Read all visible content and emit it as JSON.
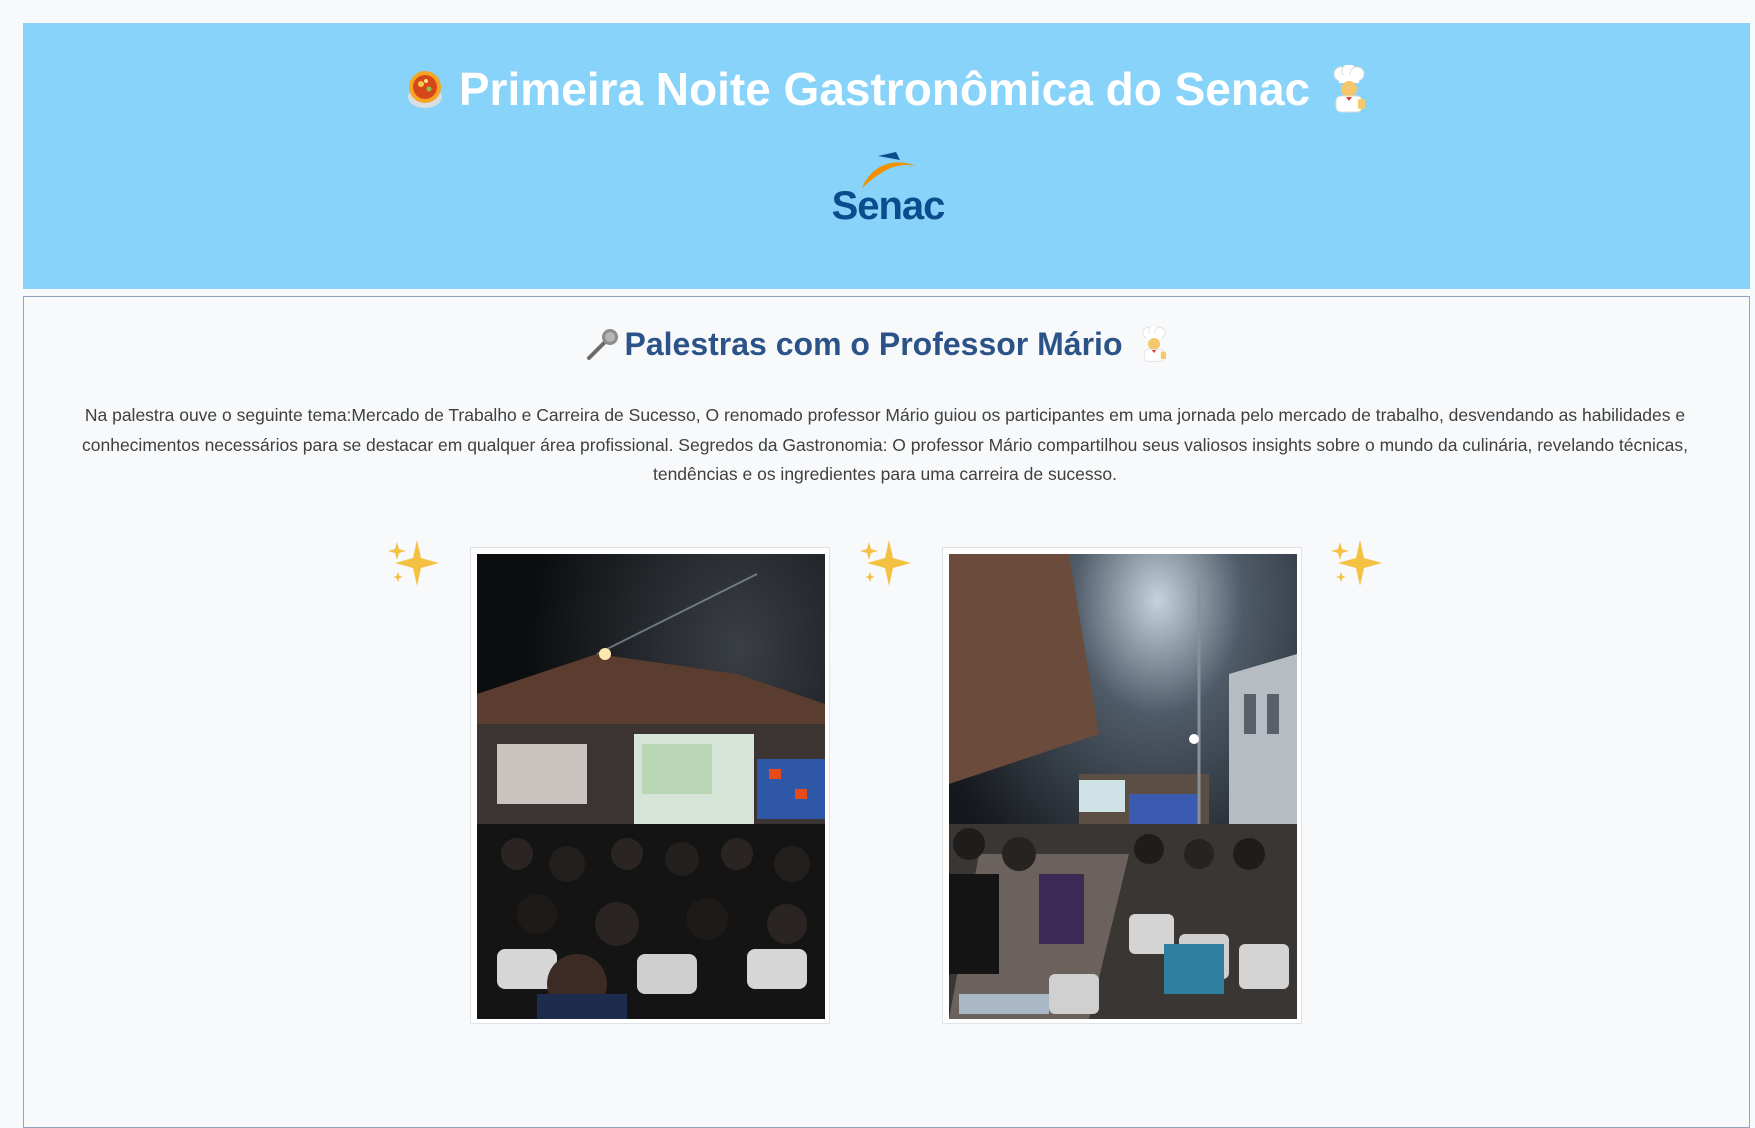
{
  "header": {
    "title": "Primeira Noite Gastronômica do Senac",
    "logo_text": "Senac",
    "background_color": "#87d3f9",
    "title_color": "#ffffff"
  },
  "section": {
    "title": "Palestras com o Professor Mário",
    "title_color": "#2c5387",
    "paragraph": "Na palestra ouve o seguinte tema:Mercado de Trabalho e Carreira de Sucesso, O renomado professor Mário guiou os participantes em uma jornada pelo mercado de trabalho, desvendando as habilidades e conhecimentos necessários para se destacar em qualquer área profissional. Segredos da Gastronomia: O professor Mário compartilhou seus valiosos insights sobre o mundo da culinária, revelando técnicas, tendências e os ingredientes para uma carreira de sucesso."
  },
  "icons": {
    "title_left": "cooking-pot-icon",
    "title_right": "chef-icon",
    "section_left": "microphone-icon",
    "section_right": "chef-icon",
    "decorations": [
      "sparkles-icon",
      "sparkles-icon",
      "sparkles-icon"
    ]
  },
  "gallery": {
    "photos": [
      "palestra-photo-1",
      "palestra-photo-2"
    ]
  },
  "colors": {
    "logo_blue": "#0b4c8c",
    "logo_orange": "#f29100",
    "sparkle": "#f5c142"
  }
}
